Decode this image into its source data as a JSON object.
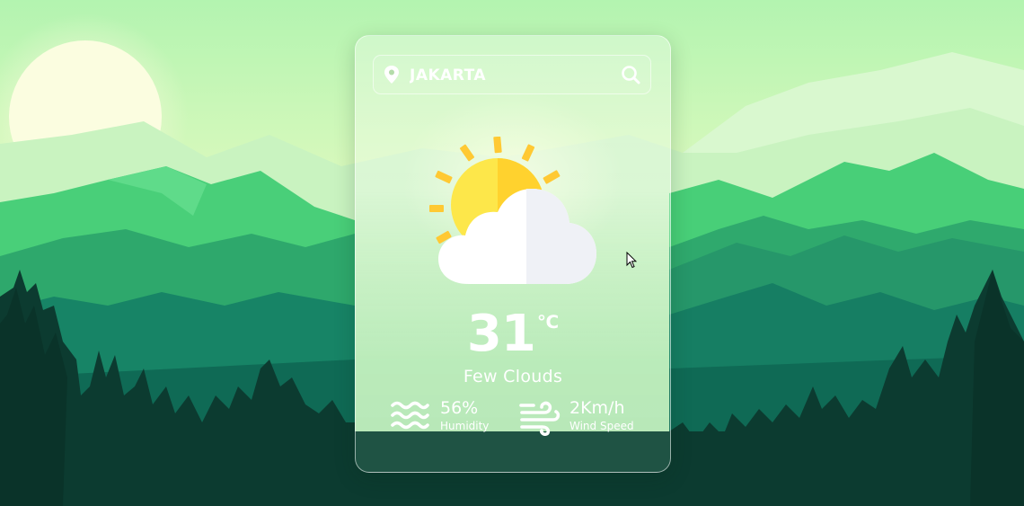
{
  "search": {
    "value": "JAKARTA",
    "location_icon": "map-pin-icon",
    "search_icon": "search-icon"
  },
  "weather": {
    "icon": "partly-cloudy-icon",
    "temperature": "31",
    "unit": "℃",
    "description": "Few Clouds"
  },
  "stats": {
    "humidity": {
      "icon": "humidity-waves-icon",
      "value": "56%",
      "label": "Humidity"
    },
    "wind": {
      "icon": "wind-icon",
      "value": "2Km/h",
      "label": "Wind Speed"
    }
  },
  "colors": {
    "sky_top": "#b8f5b0",
    "sky_bottom": "#f6fbd0",
    "mountain_light": "#4fd37c",
    "mountain_mid": "#2aa36a",
    "mountain_dark": "#137a5c",
    "forest": "#0b3a2e",
    "sun_yellow": "#ffd83b",
    "cloud_white": "#ffffff"
  }
}
